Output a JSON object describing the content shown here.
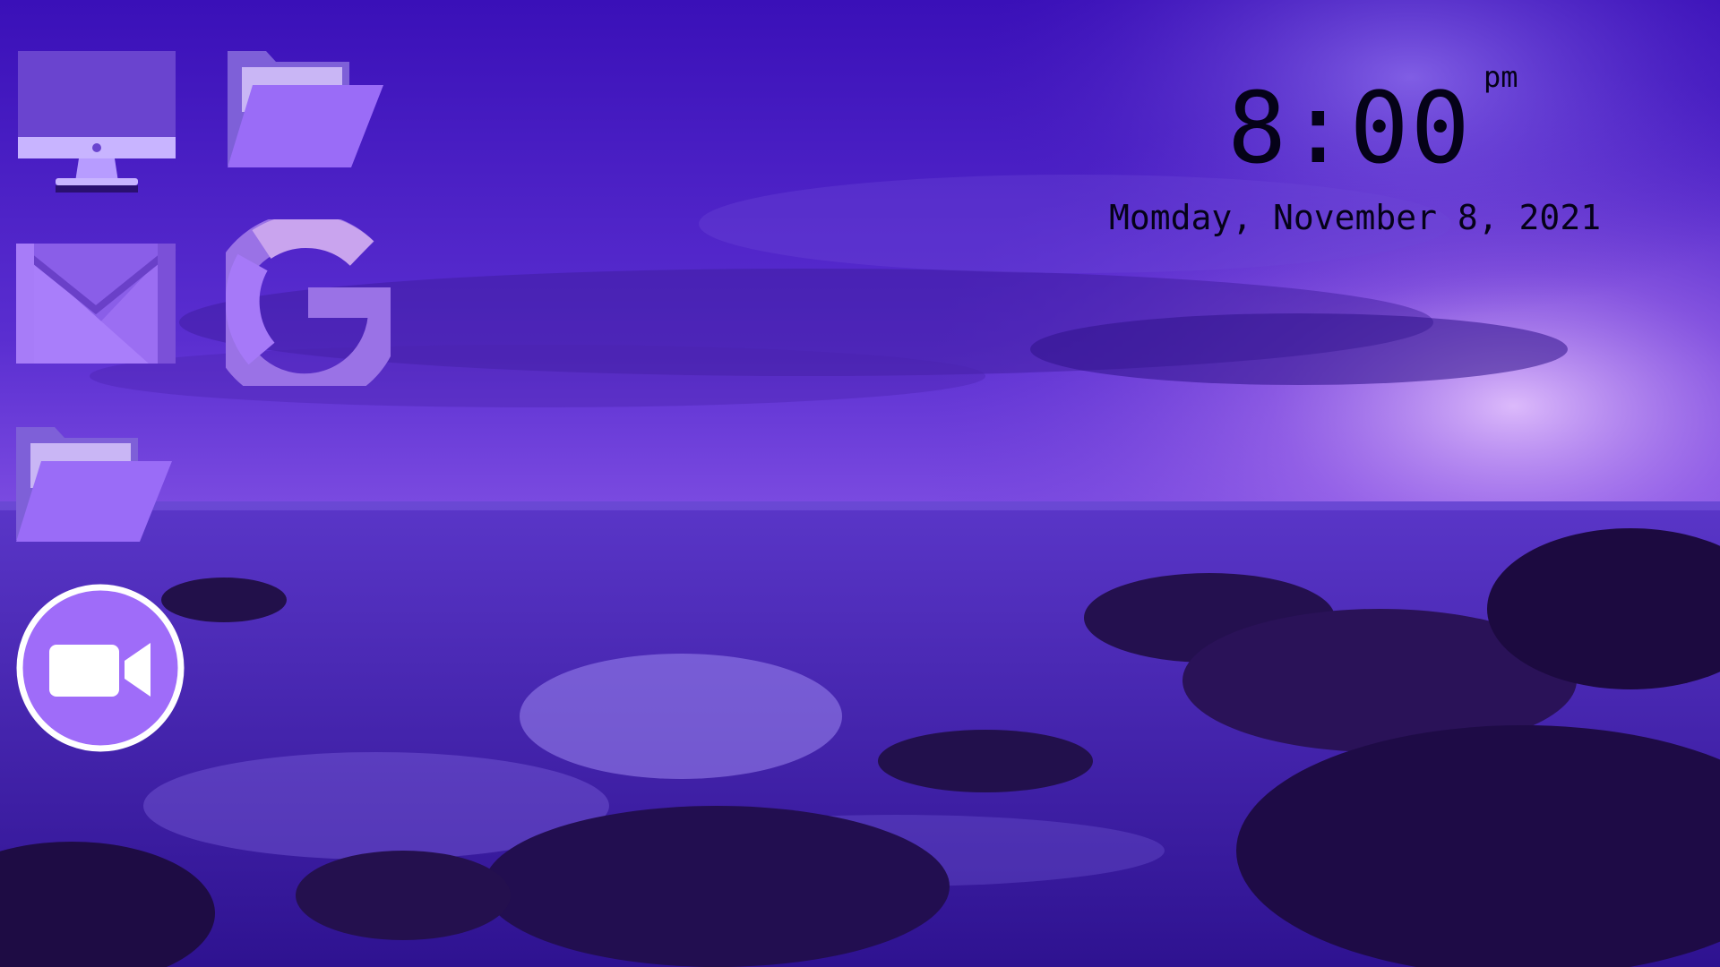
{
  "clock": {
    "time": "8:00",
    "ampm": "pm",
    "date": "Momday, November 8, 2021"
  },
  "desktop_icons": [
    {
      "name": "computer-icon"
    },
    {
      "name": "folder-icon"
    },
    {
      "name": "mail-icon"
    },
    {
      "name": "google-icon"
    },
    {
      "name": "folder-icon"
    },
    {
      "name": "video-camera-icon"
    }
  ],
  "colors": {
    "icon_light": "#b79cff",
    "icon_mid": "#9a6cf7",
    "icon_dark": "#5b2fc4",
    "text": "#050218"
  }
}
